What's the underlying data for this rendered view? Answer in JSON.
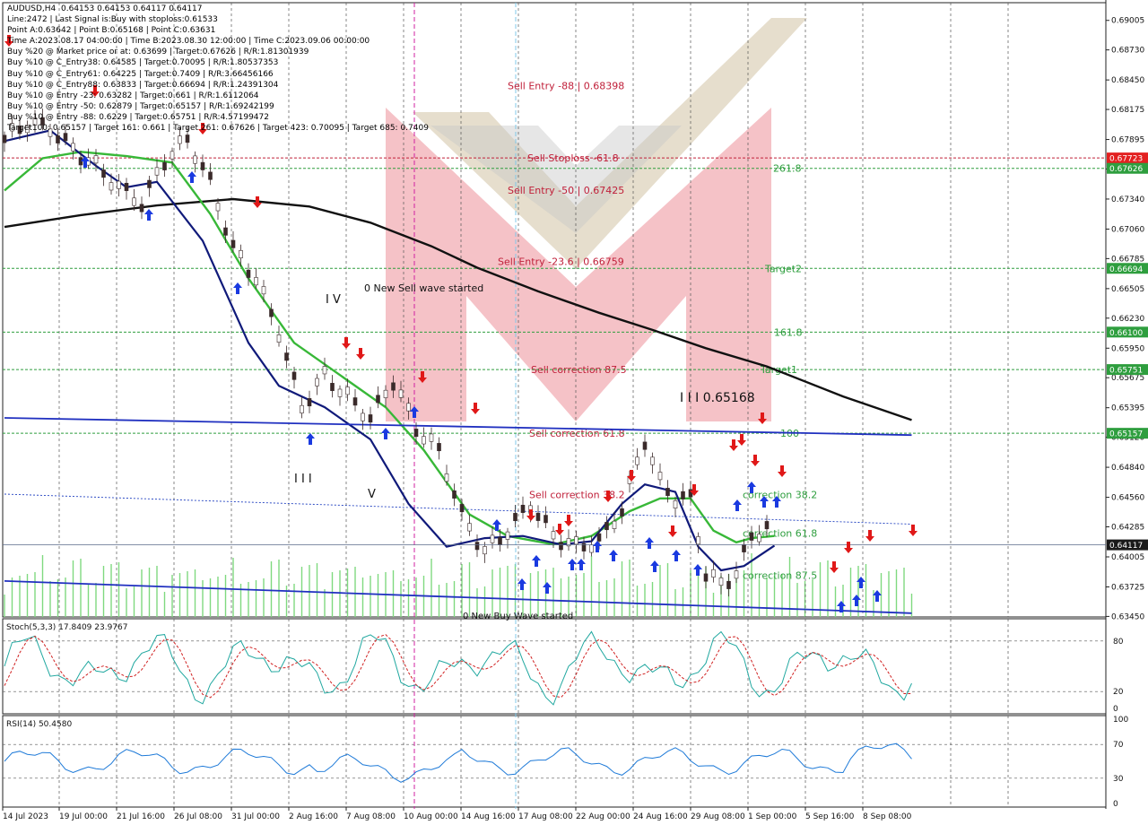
{
  "chart_data": {
    "type": "line",
    "title": "AUDUSD,H4",
    "ohlc": {
      "open": "0.64153",
      "high": "0.64153",
      "low": "0.64117",
      "close": "0.64117"
    },
    "info_lines": [
      "Line:2472 | Last Signal is:Buy with stoploss:0.61533",
      "Point A:0.63642 | Point B:0.65168 | Point C:0.63631",
      "Time A:2023.08.17 04:00:00 | Time B:2023.08.30 12:00:00 | Time C:2023.09.06 00:00:00",
      "Buy %20 @ Market price or at: 0.63699 | Target:0.67626 | R/R:1.81301939",
      "Buy %10 @ C_Entry38: 0.64585 | Target:0.70095 | R/R:1.80537353",
      "Buy %10 @ C_Entry61: 0.64225 | Target:0.7409 | R/R:3.66456166",
      "Buy %10 @ C_Entry88: 0.63833 | Target:0.66694 | R/R:1.24391304",
      "Buy %10 @ Entry -23: 0.63282 | Target:0.661 | R/R:1.6112064",
      "Buy %10 @ Entry -50: 0.62879 | Target:0.65157 | R/R:1.69242199",
      "Buy %10 @ Entry -88: 0.6229 | Target:0.65751 | R/R:4.57199472",
      "Target100: 0.65157 | Target 161: 0.661 | Target 261: 0.67626 | Target 423: 0.70095 | Target 685: 0.7409"
    ],
    "y_ticks": [
      "0.69005",
      "0.68730",
      "0.68450",
      "0.68175",
      "0.67895",
      "0.67620",
      "0.67340",
      "0.67060",
      "0.66785",
      "0.66505",
      "0.66230",
      "0.65950",
      "0.65675",
      "0.65395",
      "0.65120",
      "0.64840",
      "0.64560",
      "0.64285",
      "0.64005",
      "0.63725",
      "0.63450"
    ],
    "y_range": [
      0.63445,
      0.6917
    ],
    "x_ticks": [
      "14 Jul 2023",
      "19 Jul 00:00",
      "21 Jul 16:00",
      "26 Jul 08:00",
      "31 Jul 00:00",
      "2 Aug 16:00",
      "7 Aug 08:00",
      "10 Aug 00:00",
      "14 Aug 16:00",
      "17 Aug 08:00",
      "22 Aug 00:00",
      "24 Aug 16:00",
      "29 Aug 08:00",
      "1 Sep 00:00",
      "5 Sep 16:00",
      "8 Sep 08:00"
    ],
    "price_badges": [
      {
        "value": "0.67723",
        "color": "#e32020"
      },
      {
        "value": "0.67626",
        "color": "#2e9e3e"
      },
      {
        "value": "0.66694",
        "color": "#2e9e3e"
      },
      {
        "value": "0.66100",
        "color": "#2e9e3e"
      },
      {
        "value": "0.65751",
        "color": "#2e9e3e"
      },
      {
        "value": "0.65157",
        "color": "#2e9e3e"
      },
      {
        "value": "0.64117",
        "color": "#1a1a1a"
      }
    ],
    "levels": [
      {
        "label": "Sell Entry -88 | 0.68398",
        "value": 0.68398,
        "color": "#c0203a",
        "line": false
      },
      {
        "label": "Sell Stoploss -61.8",
        "value": 0.67723,
        "color": "#c0203a",
        "line": true
      },
      {
        "label": "261.8",
        "value": 0.67626,
        "color": "#2e9e3e",
        "line": true
      },
      {
        "label": "Sell Entry -50 | 0.67425",
        "value": 0.67425,
        "color": "#c0203a",
        "line": false
      },
      {
        "label": "Sell Entry -23.6 | 0.66759",
        "value": 0.66759,
        "color": "#c0203a",
        "line": false
      },
      {
        "label": "Target2",
        "value": 0.66694,
        "color": "#2e9e3e",
        "line": true
      },
      {
        "label": "161.8",
        "value": 0.661,
        "color": "#2e9e3e",
        "line": true
      },
      {
        "label": "Sell correction 87.5",
        "value": 0.65751,
        "color": "#c0203a",
        "line": false
      },
      {
        "label": "Target1",
        "value": 0.65751,
        "color": "#2e9e3e",
        "line": true
      },
      {
        "label": "Sell correction 61.8",
        "value": 0.65157,
        "color": "#c0203a",
        "line": false
      },
      {
        "label": "100",
        "value": 0.65157,
        "color": "#2e9e3e",
        "line": true
      },
      {
        "label": "Sell correction 38.2",
        "value": 0.64585,
        "color": "#c0203a",
        "line": false
      },
      {
        "label": "correction 38.2",
        "value": 0.64585,
        "color": "#2e9e3e",
        "line": false
      },
      {
        "label": "correction 61.8",
        "value": 0.64225,
        "color": "#2e9e3e",
        "line": false
      },
      {
        "label": "correction 87.5",
        "value": 0.63833,
        "color": "#2e9e3e",
        "line": false
      }
    ],
    "annotations": [
      "0 New Sell wave started",
      "I V",
      "I I I",
      "V",
      "I I I 0.65168",
      "0 New Buy Wave started"
    ],
    "series": [
      {
        "name": "",
        "color": "#111111",
        "x": [
          0,
          10,
          20,
          30,
          40,
          48,
          56,
          62,
          70,
          78,
          85,
          92,
          100,
          110,
          119
        ],
        "y": [
          0.6708,
          0.6719,
          0.6728,
          0.6734,
          0.6727,
          0.6712,
          0.669,
          0.667,
          0.6648,
          0.6628,
          0.6612,
          0.6595,
          0.6578,
          0.655,
          0.6528
        ]
      },
      {
        "name": "",
        "color": "#38b838",
        "x": [
          0,
          5,
          10,
          16,
          22,
          27,
          32,
          38,
          44,
          50,
          55,
          61,
          66,
          72,
          77,
          82,
          86,
          90,
          93,
          96,
          98,
          101
        ],
        "y": [
          0.6742,
          0.6772,
          0.6778,
          0.6774,
          0.6768,
          0.672,
          0.666,
          0.66,
          0.657,
          0.654,
          0.65,
          0.644,
          0.642,
          0.6412,
          0.642,
          0.6443,
          0.6455,
          0.6455,
          0.6425,
          0.6414,
          0.6418,
          0.642
        ]
      },
      {
        "name": "",
        "color": "#101a7a",
        "x": [
          0,
          6,
          12,
          16,
          20,
          26,
          32,
          36,
          42,
          48,
          53,
          58,
          63,
          68,
          73,
          77,
          81,
          84,
          88,
          91,
          94,
          97,
          101
        ],
        "y": [
          0.6788,
          0.6798,
          0.6765,
          0.6745,
          0.675,
          0.6695,
          0.66,
          0.656,
          0.654,
          0.651,
          0.645,
          0.641,
          0.6418,
          0.642,
          0.6412,
          0.6415,
          0.645,
          0.6468,
          0.6461,
          0.641,
          0.6388,
          0.6392,
          0.6411
        ]
      },
      {
        "name": "",
        "color": "#2030c0",
        "x": [
          0,
          119
        ],
        "y": [
          0.653,
          0.6514
        ]
      },
      {
        "name": "",
        "color": "#2030c0",
        "x": [
          0,
          119
        ],
        "y": [
          0.6378,
          0.6348
        ]
      },
      {
        "name": "",
        "color": "#2040c0",
        "x": [
          0,
          119
        ],
        "y": [
          0.6459,
          0.6431
        ]
      }
    ],
    "price": {
      "name": "",
      "color": "#2a1a1a",
      "x": [
        0,
        3,
        6,
        9,
        12,
        15,
        18,
        21,
        24,
        27,
        30,
        33,
        36,
        39,
        42,
        45,
        48,
        51,
        54,
        57,
        60,
        63,
        66,
        69,
        72,
        75,
        78,
        81,
        84,
        86,
        88,
        90,
        92,
        94,
        96,
        98,
        100,
        101
      ],
      "y": [
        0.679,
        0.6805,
        0.68,
        0.678,
        0.6765,
        0.6745,
        0.673,
        0.677,
        0.679,
        0.675,
        0.6688,
        0.666,
        0.661,
        0.654,
        0.657,
        0.655,
        0.653,
        0.6565,
        0.652,
        0.65,
        0.644,
        0.6405,
        0.6425,
        0.645,
        0.642,
        0.641,
        0.6415,
        0.6445,
        0.651,
        0.647,
        0.6455,
        0.6455,
        0.6385,
        0.6375,
        0.6385,
        0.642,
        0.6428,
        0.6412
      ]
    },
    "watermark": "M",
    "stoch": {
      "label": "Stoch(5,3,3) 17.8409 23.9767",
      "y_ticks": [
        "80",
        "20",
        "0"
      ],
      "levels": [
        80,
        20
      ],
      "main_color": "#21a8a0",
      "signal_color": "#d02020"
    },
    "rsi": {
      "label": "RSI(14) 50.4580",
      "y_ticks": [
        "100",
        "70",
        "30",
        "0"
      ],
      "levels": [
        70,
        30
      ],
      "color": "#1e7ad8"
    }
  }
}
